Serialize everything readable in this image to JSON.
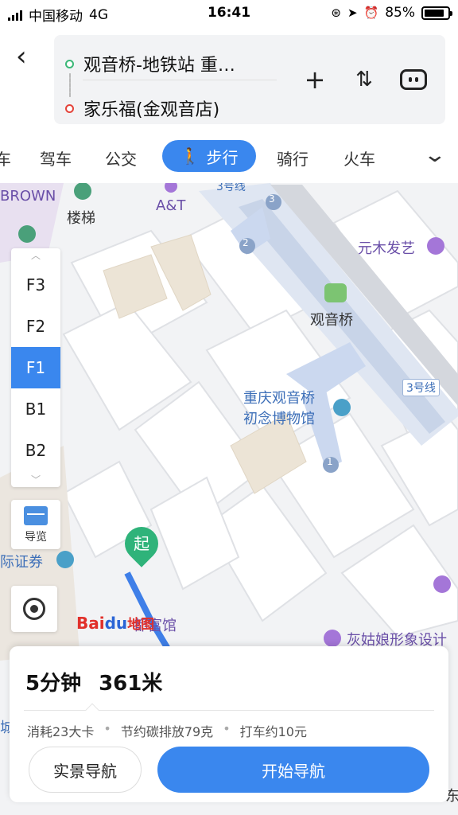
{
  "status_bar": {
    "carrier": "中国移动",
    "network": "4G",
    "time": "16:41",
    "battery": "85%"
  },
  "route": {
    "from": "观音桥-地铁站 重…",
    "to": "家乐福(金观音店)"
  },
  "header_icons": {
    "back": "back-icon",
    "add": "plus-icon",
    "switch": "switch-icon",
    "assistant": "robot-icon"
  },
  "tabs": [
    "车",
    "驾车",
    "公交",
    "步行",
    "骑行",
    "火车"
  ],
  "active_tab": "步行",
  "floors": [
    "F3",
    "F2",
    "F1",
    "B1",
    "B2"
  ],
  "active_floor": "F1",
  "guide_label": "导览",
  "map_labels": {
    "brown": "BROWN",
    "stairs": "楼梯",
    "at": "A&T",
    "line3_top": "3号线",
    "yuanmu": "元木发艺",
    "guanyinqiao": "观音桥",
    "line3_right": "3号线",
    "museum_1": "重庆观音桥",
    "museum_2": "初念博物馆",
    "securities": "际证券",
    "hotel": "都富馆",
    "huiguniang": "灰姑娘形象设计",
    "left_edge": "城",
    "right_edge": "东",
    "exit_1": "1",
    "exit_2": "2",
    "exit_3": "3"
  },
  "start_marker": "起",
  "logo": {
    "bai": "Bai",
    "du": "du",
    "map": "地图"
  },
  "summary": {
    "duration": "5分钟",
    "distance": "361米"
  },
  "stats": [
    "消耗23大卡",
    "节约碳排放79克",
    "打车约10元"
  ],
  "buttons": {
    "scene_nav": "实景导航",
    "start_nav": "开始导航"
  },
  "colors": {
    "accent": "#3a87ee",
    "start_green": "#2fb37a",
    "end_red": "#e4433a"
  }
}
